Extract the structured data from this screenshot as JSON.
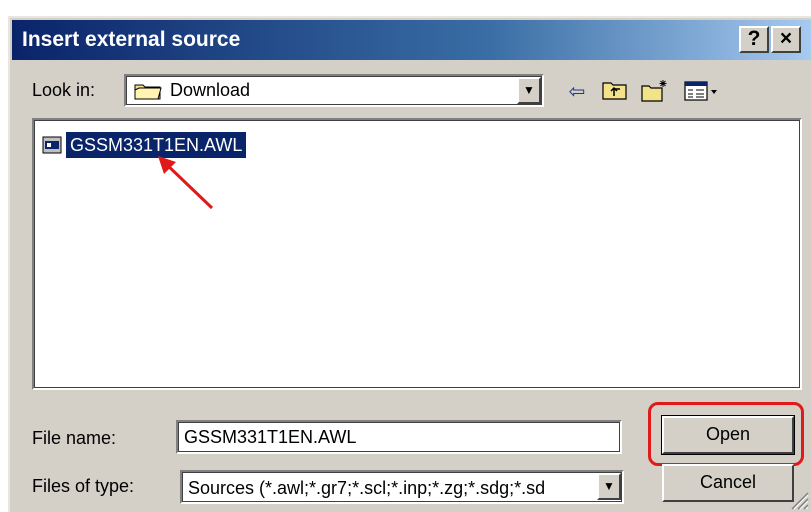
{
  "window": {
    "title": "Insert external source",
    "help_label": "?",
    "close_label": "×"
  },
  "look_in": {
    "label": "Look in:",
    "value": "Download",
    "dropdown_arrow": "▼"
  },
  "toolbar": {
    "back_icon": "⇦",
    "up_icon": "⬆",
    "new_folder_icon": "✦",
    "views_icon": "▦▾"
  },
  "file_list": {
    "items": [
      {
        "name": "GSSM331T1EN.AWL",
        "selected": true
      }
    ]
  },
  "file_name": {
    "label": "File name:",
    "value": "GSSM331T1EN.AWL"
  },
  "files_of_type": {
    "label": "Files of type:",
    "value": "Sources (*.awl;*.gr7;*.scl;*.inp;*.zg;*.sdg;*.sd",
    "dropdown_arrow": "▼"
  },
  "buttons": {
    "open_label": "Open",
    "cancel_label": "Cancel"
  },
  "colors": {
    "selection": "#0a246a",
    "annotation": "#e01919",
    "dialog_bg": "#d4d0c8"
  }
}
